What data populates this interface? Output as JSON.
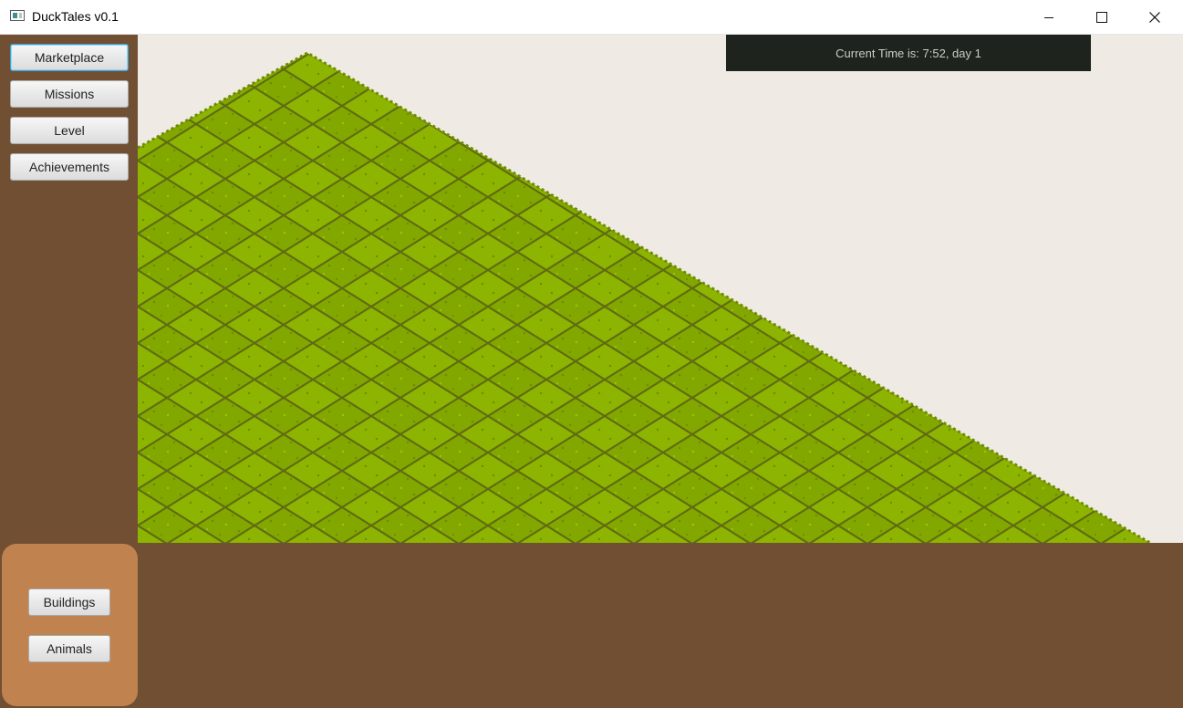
{
  "window": {
    "title": "DuckTales v0.1",
    "icons": [
      "app-icon",
      "minimize-icon",
      "maximize-icon",
      "close-icon"
    ]
  },
  "sidebar": {
    "buttons": [
      {
        "label": "Marketplace"
      },
      {
        "label": "Missions"
      },
      {
        "label": "Level"
      },
      {
        "label": "Achievements"
      }
    ]
  },
  "tool_panel": {
    "buttons": [
      {
        "label": "Buildings"
      },
      {
        "label": "Animals"
      }
    ]
  },
  "hud": {
    "time_text": "Current Time is: 7:52, day 1"
  },
  "colors": {
    "sidebar": "#714f33",
    "tool_panel": "#c0824f",
    "grass_light": "#8db400",
    "grass_dark": "#6f8c00",
    "grid_line": "#5f6b12",
    "background": "#efebe4",
    "hud_bg": "#1f231e"
  }
}
